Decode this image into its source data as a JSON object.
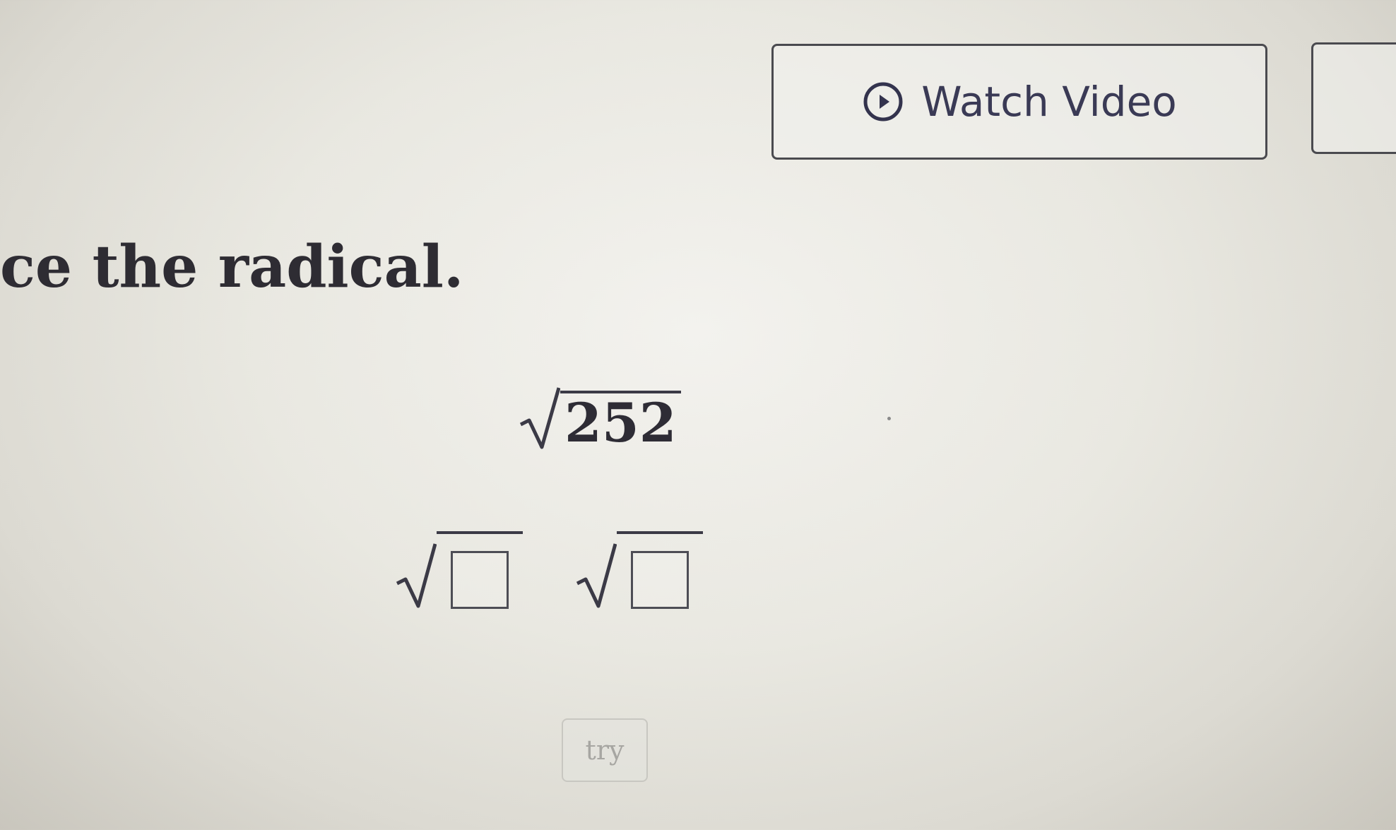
{
  "watch_video": {
    "label": "Watch Video",
    "icon": "play-circle-icon"
  },
  "question": {
    "instruction": "ce the radical."
  },
  "expression": {
    "radicand": "252"
  },
  "answer": {
    "blanks": [
      {
        "placeholder": "□"
      },
      {
        "placeholder": "□"
      }
    ]
  },
  "actions": {
    "try_label": "try"
  },
  "colors": {
    "text": "#2e2c33",
    "button_border": "#4a4a4f",
    "icon": "#3a3a55"
  }
}
